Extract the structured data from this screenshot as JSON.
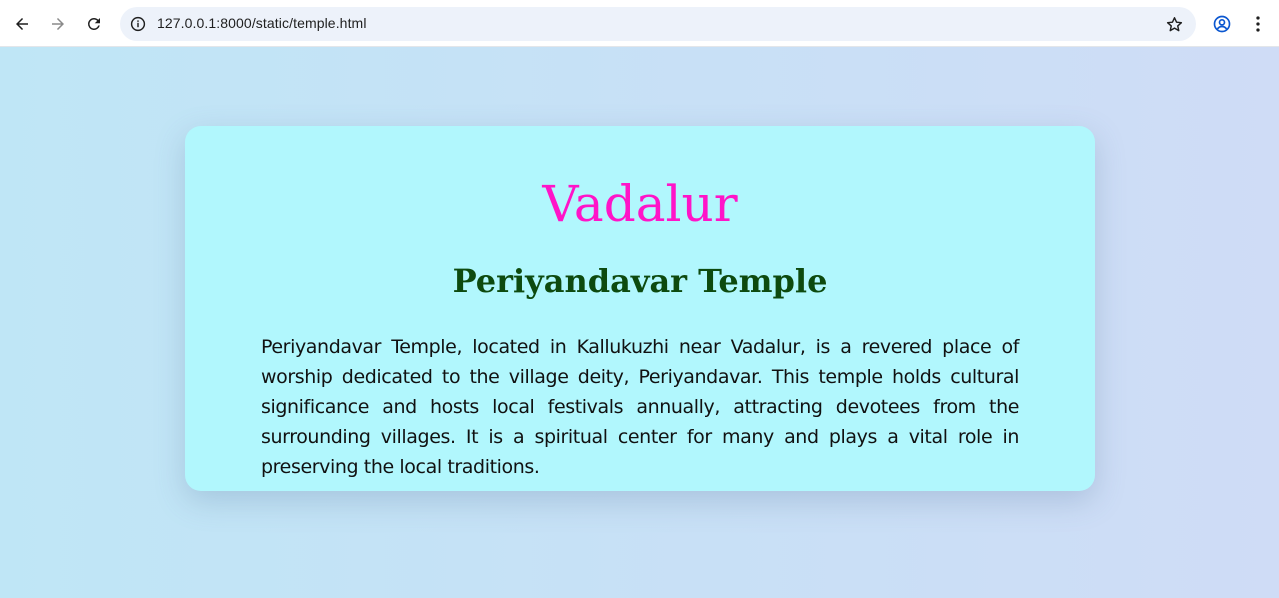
{
  "browser": {
    "url": "127.0.0.1:8000/static/temple.html",
    "icons": {
      "back": "arrow-left-icon",
      "forward": "arrow-right-icon",
      "reload": "reload-icon",
      "site_info": "info-icon",
      "bookmark": "star-icon",
      "profile": "profile-icon",
      "menu": "kebab-menu-icon"
    }
  },
  "page": {
    "place_name": "Vadalur",
    "temple_name": "Periyandavar Temple",
    "description": "Periyandavar Temple, located in Kallukuzhi near Vadalur, is a revered place of worship dedicated to the village deity, Periyandavar. This temple holds cultural significance and hosts local festivals annually, attracting devotees from the surrounding villages. It is a spiritual center for many and plays a vital role in preserving the local traditions."
  },
  "colors": {
    "place_title": "#ff14c8",
    "temple_title": "#0d4a0f",
    "card_background": "#b1f7fd",
    "page_background": "#c8e0f6"
  }
}
